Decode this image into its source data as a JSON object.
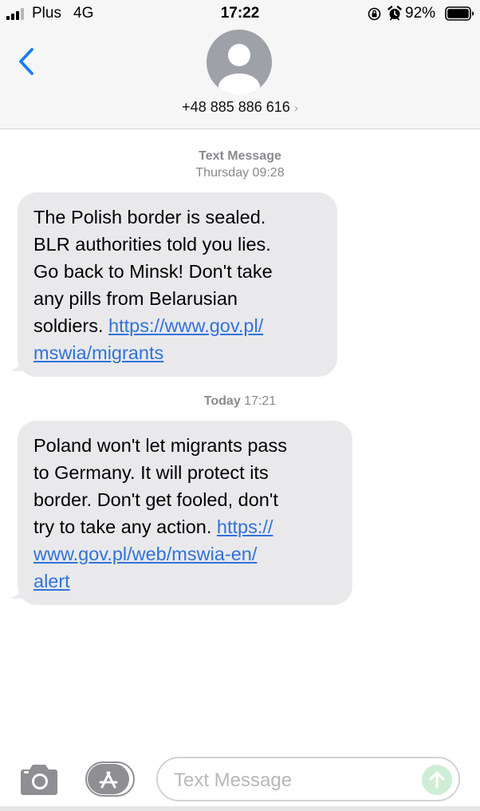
{
  "status_bar": {
    "carrier": "Plus",
    "network": "4G",
    "time": "17:22",
    "battery_percent": "92%",
    "battery_level": 0.92,
    "icons": [
      "signal-icon",
      "orientation-lock-icon",
      "alarm-icon",
      "battery-icon"
    ]
  },
  "header": {
    "back_icon": "chevron-left-icon",
    "avatar_icon": "person-silhouette-icon",
    "contact_number": "+48 885 886 616",
    "contact_chevron": "›"
  },
  "thread": {
    "groups": [
      {
        "service": "Text Message",
        "timestamp": "Thursday 09:28",
        "message": {
          "lines": [
            "The Polish border is sealed.",
            "BLR authorities told you lies.",
            "Go back to Minsk! Don't take",
            "any pills from Belarusian"
          ],
          "line5_text": "soldiers. ",
          "line5_link": "https://www.gov.pl/",
          "line6_link": "mswia/migrants"
        }
      },
      {
        "timestamp_day": "Today",
        "timestamp_time": " 17:21",
        "message": {
          "lines": [
            "Poland won't let migrants pass",
            "to Germany. It will protect its",
            "border. Don't get fooled, don't"
          ],
          "line4_text": "try to take any action. ",
          "line4_link": "https://",
          "line5_link": "www.gov.pl/web/mswia-en/",
          "line6_link": "alert"
        }
      }
    ]
  },
  "input_bar": {
    "camera_icon": "camera-icon",
    "apps_icon": "app-store-icon",
    "placeholder": "Text Message",
    "send_icon": "arrow-up-icon"
  },
  "colors": {
    "bubble": "#e9e9eb",
    "link": "#2f73db",
    "accent": "#1a7cf5",
    "send_disabled": "#cdeed5",
    "header_bg": "#f6f6f6"
  }
}
